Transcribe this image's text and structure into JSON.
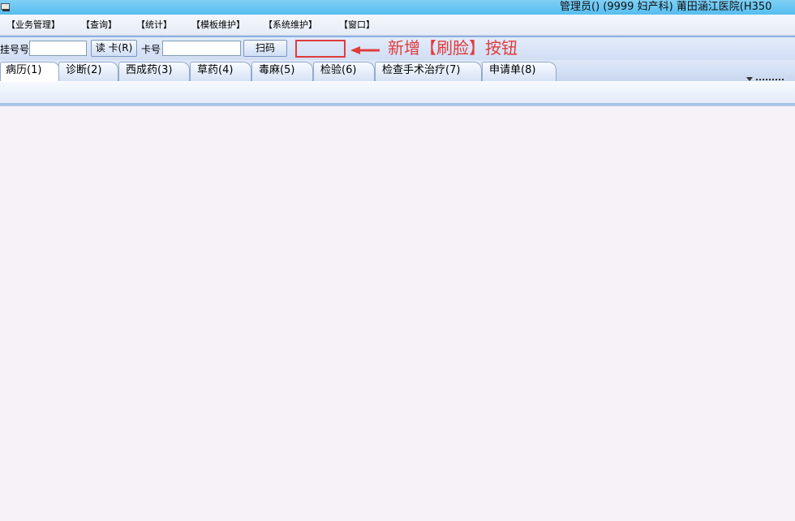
{
  "window": {
    "title": "管理员() (9999 妇产科) 莆田涵江医院(H350"
  },
  "menu": {
    "items": [
      {
        "label": "【业务管理】"
      },
      {
        "label": "【查询】"
      },
      {
        "label": "【统计】"
      },
      {
        "label": "【模板维护】"
      },
      {
        "label": "【系统维护】"
      },
      {
        "label": "【窗口】"
      }
    ]
  },
  "toolbar": {
    "registration_label": "挂号号",
    "registration_value": "",
    "read_card_label": "读 卡(R)",
    "card_label": "卡号",
    "card_value": "",
    "scan_label": "扫码",
    "annotation": "新增【刷脸】按钮",
    "annotation_color": "#e03c3c"
  },
  "tabs": [
    {
      "label": "病历(1)",
      "active": true
    },
    {
      "label": "诊断(2)",
      "active": false
    },
    {
      "label": "西成药(3)",
      "active": false
    },
    {
      "label": "草药(4)",
      "active": false
    },
    {
      "label": "毒麻(5)",
      "active": false
    },
    {
      "label": "检验(6)",
      "active": false
    },
    {
      "label": "检查手术治疗(7)",
      "active": false
    },
    {
      "label": "申请单(8)",
      "active": false
    }
  ]
}
